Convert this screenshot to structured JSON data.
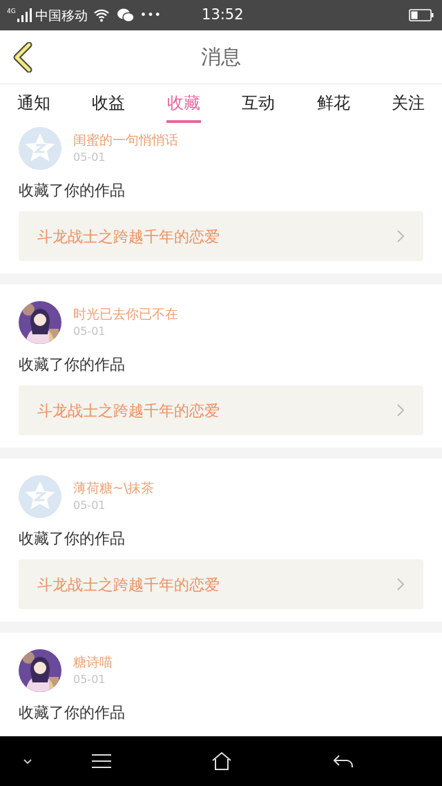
{
  "status_bar": {
    "network": "4G",
    "carrier": "中国移动",
    "dots": "•••",
    "time": "13:52"
  },
  "header": {
    "title": "消息"
  },
  "tabs": [
    {
      "label": "通知",
      "selected": false
    },
    {
      "label": "收益",
      "selected": false
    },
    {
      "label": "收藏",
      "selected": true
    },
    {
      "label": "互动",
      "selected": false
    },
    {
      "label": "鲜花",
      "selected": false
    },
    {
      "label": "关注",
      "selected": false
    }
  ],
  "messages": [
    {
      "avatar": {
        "kind": "default"
      },
      "name": "闺蜜的一句悄悄话",
      "date": "05-01",
      "action": "收藏了你的作品",
      "work": "斗龙战士之跨越千年的恋爱"
    },
    {
      "name": "时光已去你已不在",
      "date": "05-01",
      "action": "收藏了你的作品",
      "work": "斗龙战士之跨越千年的恋爱"
    },
    {
      "avatar": {
        "kind": "default"
      },
      "name": "薄荷糖~\\抹茶",
      "date": "05-01",
      "action": "收藏了你的作品",
      "work": "斗龙战士之跨越千年的恋爱"
    },
    {
      "name": "糖诗喵",
      "date": "05-01",
      "action": "收藏了你的作品"
    }
  ]
}
